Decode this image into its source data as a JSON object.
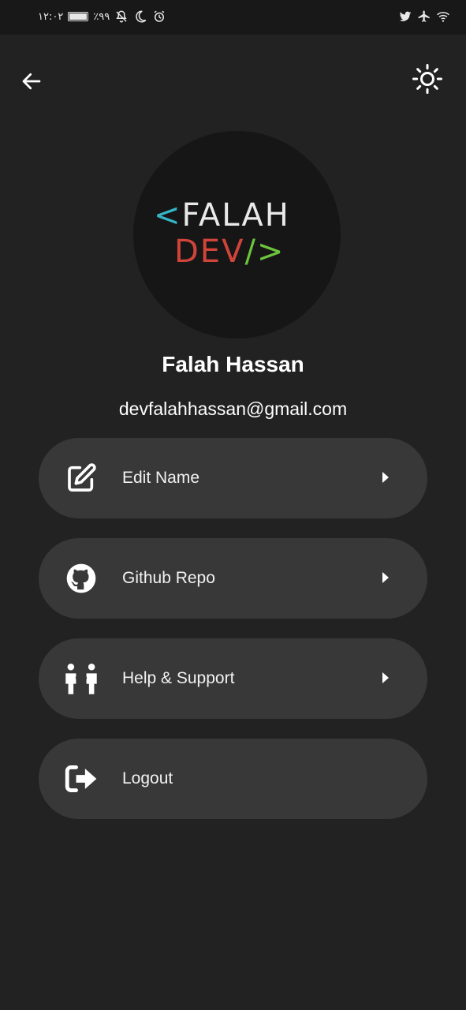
{
  "status_bar": {
    "time": "۱۲:۰۲",
    "battery": "٪۹۹",
    "icons_left": [
      "battery-icon",
      "mute-icon",
      "moon-icon",
      "alarm-icon"
    ],
    "icons_right": [
      "twitter-icon",
      "airplane-icon",
      "wifi-icon"
    ]
  },
  "header": {
    "back_icon": "arrow-left-icon",
    "theme_icon": "sun-icon"
  },
  "profile": {
    "logo_line1_bracket": "<",
    "logo_line1_text": "FALAH",
    "logo_line2_text": "DEV",
    "logo_line2_slash": "/",
    "logo_line2_bracket": ">",
    "name": "Falah Hassan",
    "email": "devfalahhassan@gmail.com"
  },
  "menu": {
    "items": [
      {
        "label": "Edit Name",
        "icon": "edit-icon",
        "has_chevron": true
      },
      {
        "label": "Github Repo",
        "icon": "github-icon",
        "has_chevron": true
      },
      {
        "label": "Help & Support",
        "icon": "support-icon",
        "has_chevron": true
      },
      {
        "label": "Logout",
        "icon": "logout-icon",
        "has_chevron": false
      }
    ]
  },
  "colors": {
    "background": "#222222",
    "status_bar": "#181818",
    "card": "#383838",
    "avatar_bg": "#161616",
    "logo_cyan": "#35b6c7",
    "logo_red": "#d0443a",
    "logo_green": "#6cc43c"
  }
}
